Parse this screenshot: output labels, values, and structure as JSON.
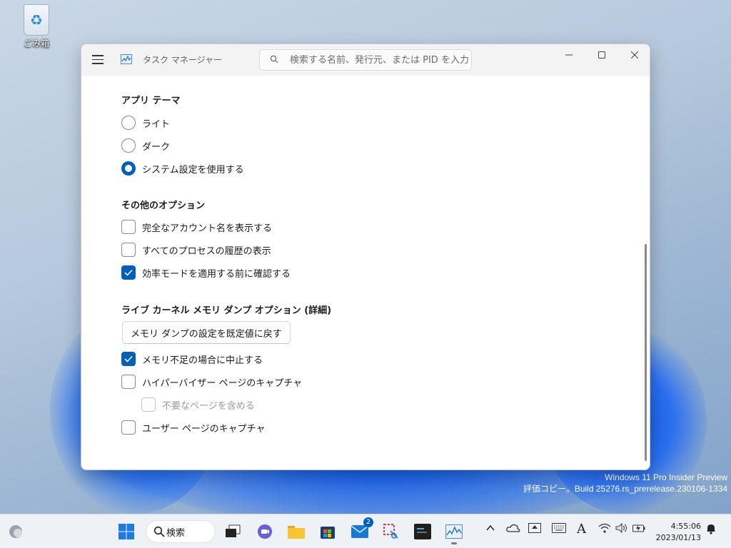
{
  "desktop": {
    "recycle_bin_label": "ごみ箱",
    "watermark_line1": "Windows 11 Pro Insider Preview",
    "watermark_line2": "評価コピー。Build 25276.rs_prerelease.230106-1334"
  },
  "window": {
    "title": "タスク マネージャー",
    "search_placeholder": "検索する名前、発行元、または PID を入力し"
  },
  "settings": {
    "theme": {
      "title": "アプリ テーマ",
      "options": [
        {
          "label": "ライト",
          "selected": false
        },
        {
          "label": "ダーク",
          "selected": false
        },
        {
          "label": "システム設定を使用する",
          "selected": true
        }
      ]
    },
    "other": {
      "title": "その他のオプション",
      "options": [
        {
          "label": "完全なアカウント名を表示する",
          "checked": false
        },
        {
          "label": "すべてのプロセスの履歴の表示",
          "checked": false
        },
        {
          "label": "効率モードを適用する前に確認する",
          "checked": true
        }
      ]
    },
    "dump": {
      "title": "ライブ カーネル メモリ ダンプ オプション (詳細)",
      "reset_button": "メモリ ダンプの設定を既定値に戻す",
      "options": [
        {
          "label": "メモリ不足の場合に中止する",
          "checked": true
        },
        {
          "label": "ハイパーバイザー ページのキャプチャ",
          "checked": false
        },
        {
          "label": "不要なページを含める",
          "checked": false,
          "disabled": true
        },
        {
          "label": "ユーザー ページのキャプチャ",
          "checked": false
        }
      ]
    }
  },
  "taskbar": {
    "search_label": "検索",
    "mail_badge": "2",
    "time": "4:55:06",
    "date": "2023/01/13",
    "ime_label": "A"
  },
  "colors": {
    "accent": "#005fb8"
  }
}
